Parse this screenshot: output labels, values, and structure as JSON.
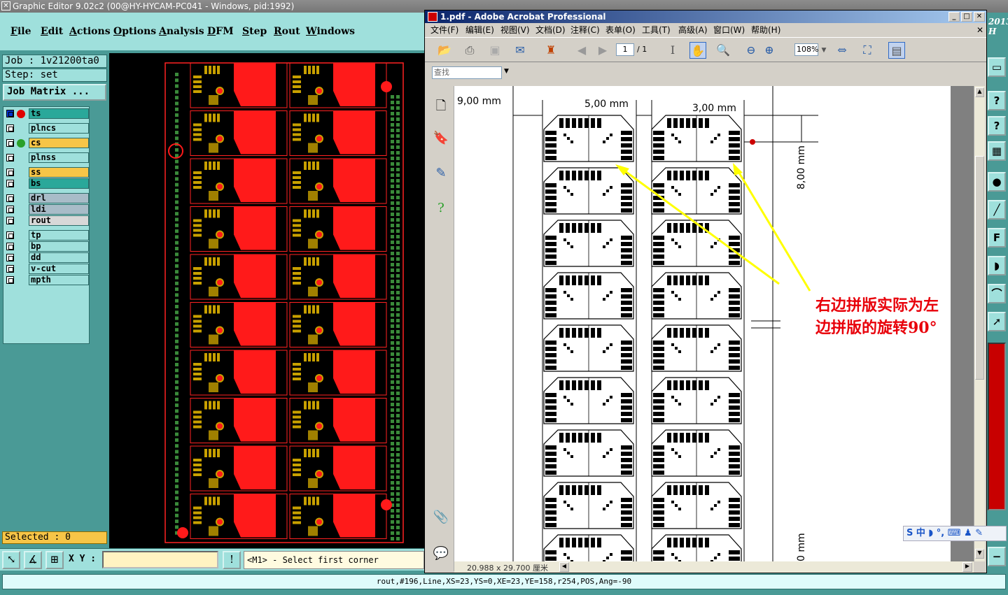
{
  "editor": {
    "title": "Graphic Editor 9.02c2 (00@HY-HYCAM-PC041 - Windows, pid:1992)",
    "menu": [
      "File",
      "Edit",
      "Actions",
      "Options",
      "Analysis",
      "DFM",
      "Step",
      "Rout",
      "Windows"
    ],
    "job_label": "Job : 1v21200ta0",
    "step_label": "Step: set",
    "job_matrix_button": "Job Matrix ...",
    "layers": [
      {
        "name": "ts",
        "color": "#2aa89a",
        "dot": "#e00000",
        "checked": true
      },
      {
        "name": "plncs",
        "color": "#9fe0dc",
        "dot": "",
        "checked": false
      },
      {
        "name": "cs",
        "color": "#f7c547",
        "dot": "#2aa02a",
        "checked": false
      },
      {
        "name": "plnss",
        "color": "#9fe0dc",
        "dot": "",
        "checked": false
      },
      {
        "name": "ss",
        "color": "#f7c547",
        "dot": "",
        "checked": false
      },
      {
        "name": "bs",
        "color": "#2aa89a",
        "dot": "",
        "checked": false
      },
      {
        "name": "drl",
        "color": "#a8bcc8",
        "dot": "",
        "checked": false
      },
      {
        "name": "ldi",
        "color": "#a8bcc8",
        "dot": "",
        "checked": false
      },
      {
        "name": "rout",
        "color": "#d8d8d8",
        "dot": "",
        "checked": false
      },
      {
        "name": "tp",
        "color": "#9fe0dc",
        "dot": "",
        "checked": false
      },
      {
        "name": "bp",
        "color": "#9fe0dc",
        "dot": "",
        "checked": false
      },
      {
        "name": "dd",
        "color": "#9fe0dc",
        "dot": "",
        "checked": false
      },
      {
        "name": "v-cut",
        "color": "#9fe0dc",
        "dot": "",
        "checked": false
      },
      {
        "name": "mpth",
        "color": "#9fe0dc",
        "dot": "",
        "checked": false
      }
    ],
    "selected": "Selected : 0",
    "xy_label": "X Y :",
    "xy_value": "",
    "prompt": "<M1> - Select first corner",
    "status": "rout,#196,Line,XS=23,YS=0,XE=23,YE=158,r254,POS,Ang=-90"
  },
  "acrobat": {
    "title": "1.pdf - Adobe Acrobat Professional",
    "menu": [
      "文件(F)",
      "编辑(E)",
      "视图(V)",
      "文档(D)",
      "注释(C)",
      "表单(O)",
      "工具(T)",
      "高级(A)",
      "窗口(W)",
      "帮助(H)"
    ],
    "page_current": "1",
    "page_total": "/ 1",
    "zoom": "108%",
    "search_placeholder": "查找",
    "page_size": "20.988 x 29.700 厘米",
    "dims": {
      "d9": "9,00 mm",
      "d5": "5,00 mm",
      "d3": "3,00 mm",
      "d8": "8,00 mm",
      "d_bottom": "0 mm"
    },
    "annotation_line1": "右边拼版实际为左",
    "annotation_line2": "边拼版的旋转90°"
  },
  "right_strip_text": "2013 H",
  "ime": "S 中 ◗ °, ⌨ ♟ ✎",
  "colors": {
    "editor_bg": "#4a9a96",
    "panel": "#9fe0dc",
    "copper": "#ff1a1a",
    "pad": "#c8a000",
    "arrow": "#ffff00",
    "annotation": "#e8000a"
  }
}
